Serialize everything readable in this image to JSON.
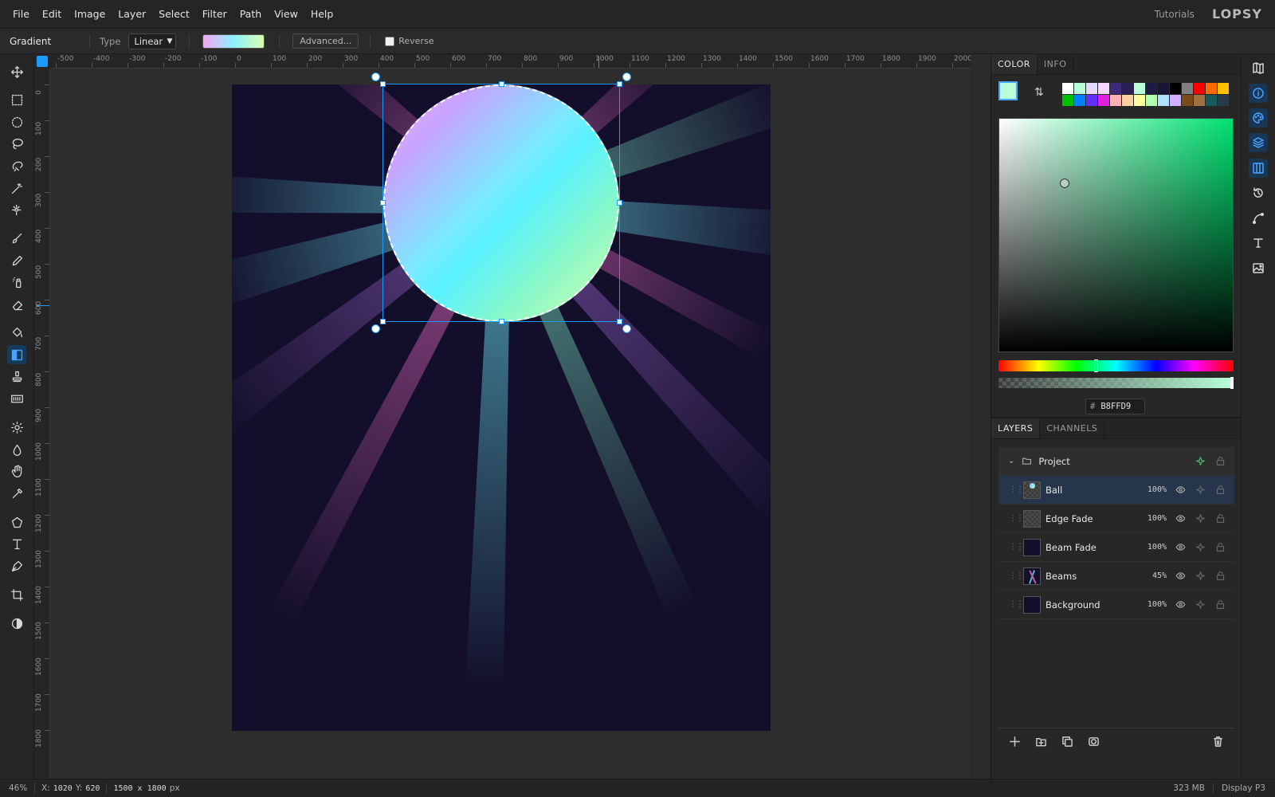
{
  "menu": {
    "items": [
      "File",
      "Edit",
      "Image",
      "Layer",
      "Select",
      "Filter",
      "Path",
      "View",
      "Help"
    ],
    "tutorials": "Tutorials",
    "logo": "LOPSY"
  },
  "options": {
    "tool_name": "Gradient",
    "type_label": "Type",
    "type_value": "Linear",
    "advanced_label": "Advanced...",
    "reverse_label": "Reverse",
    "reverse_checked": false,
    "gradient_colors": [
      "#f4a6f2",
      "#8ef0ff",
      "#d9ffad"
    ]
  },
  "ruler": {
    "top_labels": [
      "-500",
      "-400",
      "-300",
      "-200",
      "-100",
      "0",
      "100",
      "200",
      "300",
      "400",
      "500",
      "600",
      "700",
      "800",
      "900",
      "1000",
      "1100",
      "1200",
      "1300",
      "1400",
      "1500",
      "1600",
      "1700",
      "1800",
      "1900",
      "2000"
    ],
    "left_labels": [
      "0",
      "100",
      "200",
      "300",
      "400",
      "500",
      "600",
      "700",
      "800",
      "900",
      "1000",
      "1100",
      "1200",
      "1300",
      "1400",
      "1500",
      "1600",
      "1700",
      "1800"
    ]
  },
  "tools": [
    "move-icon",
    "rect-select-icon",
    "ellipse-select-icon",
    "lasso-icon",
    "magnetic-lasso-icon",
    "magic-wand-icon",
    "quick-select-icon",
    "brush-icon",
    "pencil-icon",
    "spray-icon",
    "eraser-icon",
    "bucket-icon",
    "gradient-icon",
    "stamp-icon",
    "pattern-icon",
    "dodge-icon",
    "blur-icon",
    "smudge-icon",
    "eyedropper-icon",
    "shape-icon",
    "text-icon",
    "pen-icon",
    "crop-icon",
    "contrast-icon"
  ],
  "color_panel": {
    "tabs": [
      "COLOR",
      "INFO"
    ],
    "active_tab": "COLOR",
    "foreground": "#b8ffd9",
    "background": "#ffffff",
    "hex_value": "B8FFD9",
    "swatches": [
      "#ffffff",
      "#b8ffd9",
      "#e6d9ff",
      "#f4d6ff",
      "#3a2a7a",
      "#2b1f5a",
      "#b8ffd9",
      "#1f1a40",
      "#1a1535",
      "#000000",
      "#808080",
      "#ff0000",
      "#ff6a00",
      "#ffc000",
      "#00c000",
      "#0080ff",
      "#6030ff",
      "#e020e0",
      "#ffb0b0",
      "#ffd0a0",
      "#ffffa0",
      "#b0ffb0",
      "#b0e0ff",
      "#d0b0ff",
      "#7a4a1a",
      "#a07040",
      "#1a5a5a",
      "#2a3a4a"
    ]
  },
  "layers_panel": {
    "tabs": [
      "LAYERS",
      "CHANNELS"
    ],
    "active_tab": "LAYERS",
    "group": {
      "name": "Project"
    },
    "layers": [
      {
        "name": "Ball",
        "opacity": "100%",
        "selected": true
      },
      {
        "name": "Edge Fade",
        "opacity": "100%",
        "selected": false
      },
      {
        "name": "Beam Fade",
        "opacity": "100%",
        "selected": false
      },
      {
        "name": "Beams",
        "opacity": "45%",
        "selected": false
      },
      {
        "name": "Background",
        "opacity": "100%",
        "selected": false
      }
    ]
  },
  "status": {
    "zoom": "46%",
    "x_label": "X:",
    "x_value": "1020",
    "y_label": "Y:",
    "y_value": "620",
    "doc_size": "1500 x 1800",
    "doc_unit": "px",
    "memory": "323 MB",
    "color_profile": "Display P3"
  }
}
